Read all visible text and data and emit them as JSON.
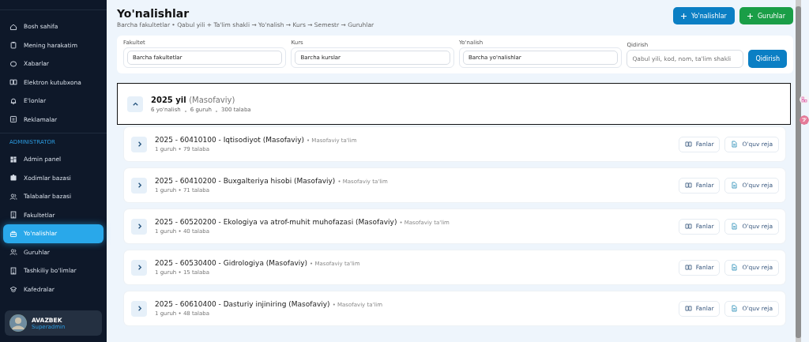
{
  "sidebar": {
    "items": [
      {
        "label": "Bosh sahifa",
        "selected": false
      },
      {
        "label": "Mening harakatim",
        "selected": false
      },
      {
        "label": "Xabarlar",
        "selected": false
      },
      {
        "label": "Elektron kutubxona",
        "selected": false
      },
      {
        "label": "E'lonlar",
        "selected": false
      },
      {
        "label": "Reklamalar",
        "selected": false
      }
    ],
    "section": "ADMINISTRATOR",
    "admin_items": [
      {
        "label": "Admin panel",
        "selected": false
      },
      {
        "label": "Xodimlar bazasi",
        "selected": false
      },
      {
        "label": "Talabalar bazasi",
        "selected": false
      },
      {
        "label": "Fakultetlar",
        "selected": false
      },
      {
        "label": "Yo'nalishlar",
        "selected": true
      },
      {
        "label": "Guruhlar",
        "selected": false
      },
      {
        "label": "Tashkiliy bo'limlar",
        "selected": false
      },
      {
        "label": "Kafedralar",
        "selected": false
      }
    ],
    "user": {
      "name": "AVAZBEK",
      "role": "Superadmin"
    }
  },
  "header": {
    "title": "Yo'nalishlar",
    "breadcrumb": "Barcha fakultetlar • Qabul yili + Ta'lim shakli → Yo'nalish → Kurs → Semestr → Guruhlar",
    "buttons": [
      {
        "label": "Yo'nalishlar",
        "color": "#0b7fc4"
      },
      {
        "label": "Guruhlar",
        "color": "#1a9e47"
      }
    ]
  },
  "filters": [
    {
      "label": "Fakultet",
      "value": "Barcha fakultetlar"
    },
    {
      "label": "Kurs",
      "value": "Barcha kurslar"
    },
    {
      "label": "Yo'nalish",
      "value": "Barcha yo'nalishlar"
    }
  ],
  "search": {
    "label": "Qidirish",
    "placeholder": "Qabul yili, kod, nom, ta'lim shakli",
    "button": "Qidirish"
  },
  "group": {
    "title": "2025 yil",
    "mode": "(Masofaviy)",
    "expanded": true,
    "stats": [
      "6 yo'nalish",
      "6 guruh",
      "300 talaba"
    ],
    "rows": [
      {
        "title": "2025 - 60410100 - Iqtisodiyot (Masofaviy)",
        "tag": "• Masofaviy ta'lim",
        "meta": "1 guruh • 79 talaba",
        "actions": [
          "Fanlar",
          "O'quv reja"
        ]
      },
      {
        "title": "2025 - 60410200 - Buxgalteriya hisobi (Masofaviy)",
        "tag": "• Masofaviy ta'lim",
        "meta": "1 guruh • 71 talaba",
        "actions": [
          "Fanlar",
          "O'quv reja"
        ]
      },
      {
        "title": "2025 - 60520200 - Ekologiya va atrof-muhit muhofazasi (Masofaviy)",
        "tag": "• Masofaviy ta'lim",
        "meta": "1 guruh • 40 talaba",
        "actions": [
          "Fanlar",
          "O'quv reja"
        ]
      },
      {
        "title": "2025 - 60530400 - Gidrologiya (Masofaviy)",
        "tag": "• Masofaviy ta'lim",
        "meta": "1 guruh • 15 talaba",
        "actions": [
          "Fanlar",
          "O'quv reja"
        ]
      },
      {
        "title": "2025 - 60610400 - Dasturiy injiniring (Masofaviy)",
        "tag": "• Masofaviy ta'lim",
        "meta": "1 guruh • 48 talaba",
        "actions": [
          "Fanlar",
          "O'quv reja"
        ]
      }
    ]
  }
}
